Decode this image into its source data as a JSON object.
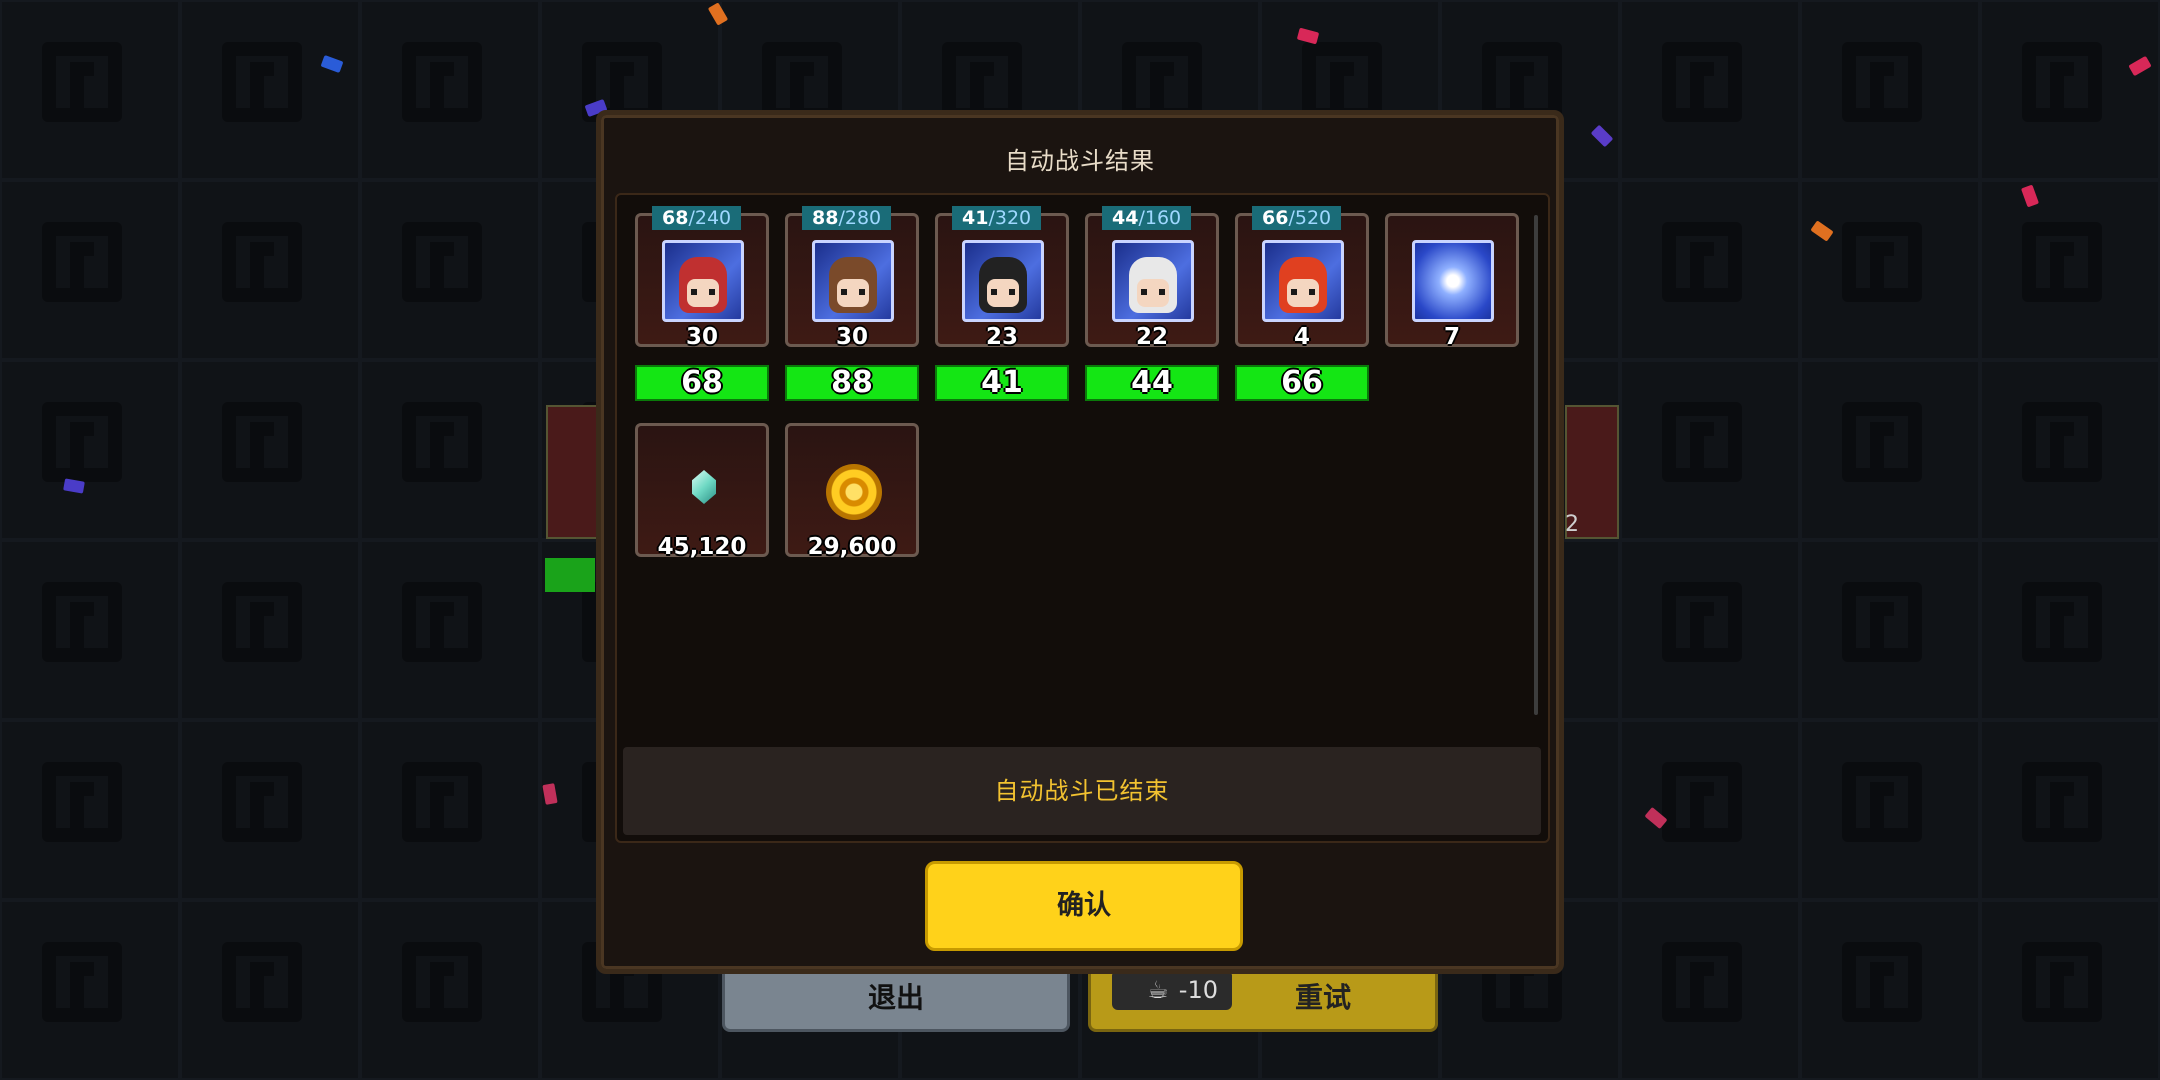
{
  "modal": {
    "title": "自动战斗结果",
    "status_text": "自动战斗已结束",
    "confirm_label": "确认"
  },
  "heroes": [
    {
      "xp_gained": "68",
      "xp_max": "/240",
      "level": "30",
      "xp_value": "68",
      "hair": "#c03030"
    },
    {
      "xp_gained": "88",
      "xp_max": "/280",
      "level": "30",
      "xp_value": "88",
      "hair": "#7a4a2a"
    },
    {
      "xp_gained": "41",
      "xp_max": "/320",
      "level": "23",
      "xp_value": "41",
      "hair": "#222222"
    },
    {
      "xp_gained": "44",
      "xp_max": "/160",
      "level": "22",
      "xp_value": "44",
      "hair": "#e8e8e8"
    },
    {
      "xp_gained": "66",
      "xp_max": "/520",
      "level": "4",
      "xp_value": "66",
      "hair": "#e04020"
    }
  ],
  "rewards": {
    "star_item_count": "7",
    "crystal_count": "45,120",
    "gold_count": "29,600"
  },
  "background": {
    "exit_label": "退出",
    "retry_label": "重试",
    "retry_cost": "-10",
    "partial_count": "2"
  },
  "colors": {
    "confirm_button": "#ffd21a",
    "status_text": "#f2c230",
    "xp_bar": "#14e614"
  }
}
